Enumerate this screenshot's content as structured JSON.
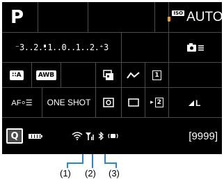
{
  "screen": {
    "mode": "P",
    "iso": {
      "badge": "ISO",
      "value": "AUTO"
    },
    "exposure_scale": "⁻3..2..1..0..1..2.⁺3",
    "row3": {
      "picture_style": "∷A",
      "wb": "AWB",
      "lens": "▣",
      "tone": "∿∧",
      "drive_single": "1"
    },
    "row4": {
      "af_method": "AF⸰☰",
      "af_operation": "ONE SHOT",
      "metering": "◎",
      "frame": "□",
      "timer": "▸ 2",
      "quality": "◢L"
    },
    "row5": {
      "q_label": "Q",
      "shots": "[9999]"
    }
  },
  "callouts": [
    "(1)",
    "(2)",
    "(3)"
  ]
}
